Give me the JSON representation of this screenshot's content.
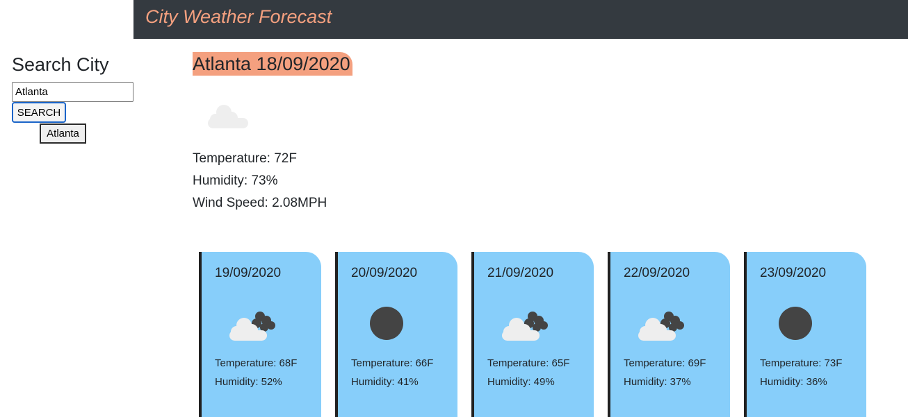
{
  "header": {
    "title": "City Weather Forecast"
  },
  "colors": {
    "accent": "#f4a07f",
    "navbar": "#343a40",
    "card": "#87cefa"
  },
  "search": {
    "heading": "Search City",
    "input_value": "Atlanta",
    "button_label": "SEARCH",
    "history": [
      "Atlanta"
    ]
  },
  "current": {
    "title": "Atlanta 18/09/2020",
    "icon": "cloud-icon",
    "temperature": "Temperature: 72F",
    "humidity": "Humidity: 73%",
    "wind": "Wind Speed: 2.08MPH"
  },
  "forecast": [
    {
      "date": "19/09/2020",
      "icon": "cloudy-icon",
      "temperature": "Temperature: 68F",
      "humidity": "Humidity: 52%"
    },
    {
      "date": "20/09/2020",
      "icon": "dark-circle-icon",
      "temperature": "Temperature: 66F",
      "humidity": "Humidity: 41%"
    },
    {
      "date": "21/09/2020",
      "icon": "cloudy-icon",
      "temperature": "Temperature: 65F",
      "humidity": "Humidity: 49%"
    },
    {
      "date": "22/09/2020",
      "icon": "cloudy-icon",
      "temperature": "Temperature: 69F",
      "humidity": "Humidity: 37%"
    },
    {
      "date": "23/09/2020",
      "icon": "dark-circle-icon",
      "temperature": "Temperature: 73F",
      "humidity": "Humidity: 36%"
    }
  ]
}
